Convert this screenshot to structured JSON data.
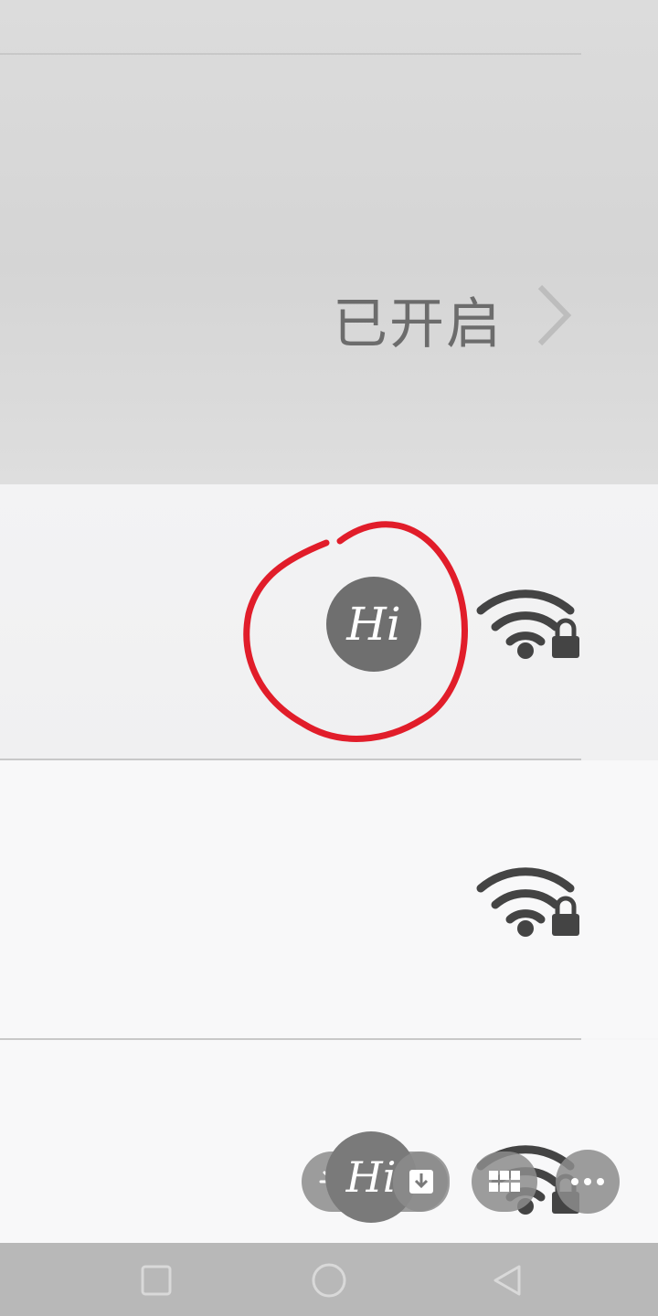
{
  "settings_row": {
    "status_label": "已开启",
    "chevron": "chevron-right-icon"
  },
  "wifi_list": [
    {
      "network_icon": "hi-hotspot-icon",
      "signal_icon": "wifi-lock-icon",
      "annotated": true
    },
    {
      "signal_icon": "wifi-lock-icon"
    },
    {
      "network_icon": "hi-hotspot-icon",
      "signal_icon": "wifi-lock-icon"
    }
  ],
  "hi_label": "Hi",
  "floating_toolbar": [
    "sparkle-icon",
    "download-icon",
    "grid-icon",
    "more-icon"
  ],
  "nav_bar": [
    "square-icon",
    "circle-icon",
    "back-triangle-icon"
  ],
  "colors": {
    "annotation": "#e11d2a",
    "icon": "#666666",
    "wifi": "#444444"
  }
}
